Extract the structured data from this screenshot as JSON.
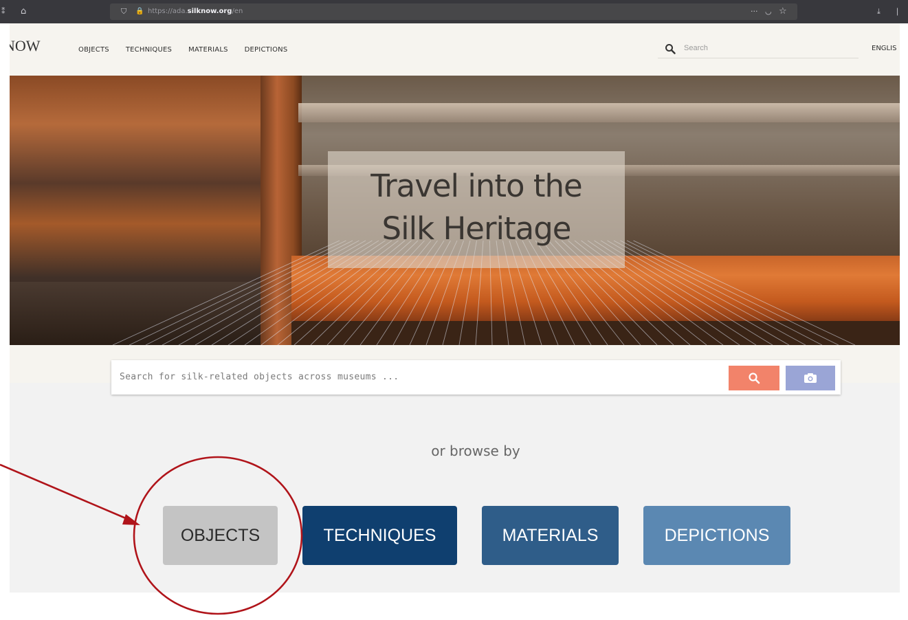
{
  "browser": {
    "url_prefix": "https://ada.",
    "url_domain": "silknow.org",
    "url_path": "/en"
  },
  "header": {
    "logo": "NOW",
    "nav": [
      "OBJECTS",
      "TECHNIQUES",
      "MATERIALS",
      "DEPICTIONS"
    ],
    "search_placeholder": "Search",
    "language": "ENGLIS"
  },
  "hero": {
    "title_line1": "Travel into the",
    "title_line2": "Silk Heritage"
  },
  "search": {
    "placeholder": "Search for silk-related objects across museums ..."
  },
  "browse": {
    "label": "or browse by",
    "categories": [
      "OBJECTS",
      "TECHNIQUES",
      "MATERIALS",
      "DEPICTIONS"
    ]
  },
  "colors": {
    "search_button": "#f2836a",
    "camera_button": "#9aa5d6",
    "objects": "#c4c4c4",
    "techniques": "#0f3f6f",
    "materials": "#2f5d89",
    "depictions": "#5b88b2",
    "annotation": "#b0141a"
  },
  "icons": {
    "search": "magnifier-icon",
    "camera": "camera-icon",
    "home": "home-icon",
    "shield": "shield-icon",
    "lock": "lock-icon",
    "more": "more-icon",
    "pocket": "pocket-icon",
    "star": "star-icon",
    "download": "download-icon"
  }
}
